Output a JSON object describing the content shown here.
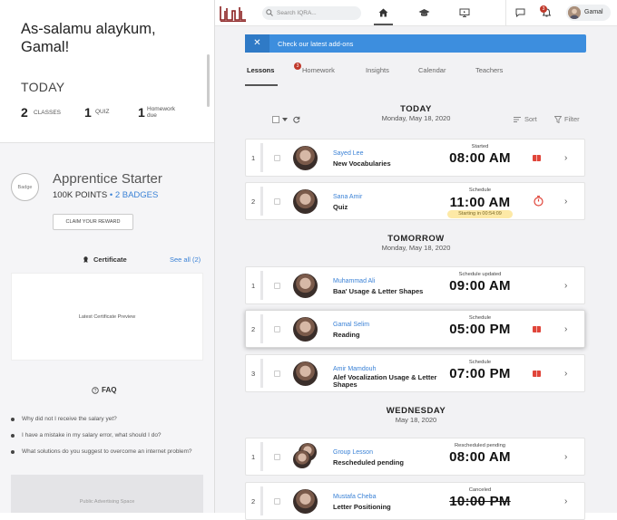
{
  "sidebar": {
    "greeting": "As-salamu alaykum, Gamal!",
    "today_label": "TODAY",
    "stats": [
      {
        "count": "2",
        "label": "CLASSES"
      },
      {
        "count": "1",
        "label": "QUIZ"
      },
      {
        "count": "1",
        "label": "Homework due"
      }
    ],
    "badge_placeholder": "Badge",
    "level_name": "Apprentice Starter",
    "points": "100K POINTS",
    "separator": "•",
    "badges": "2 BADGES",
    "claim_label": "CLAIM YOUR REWARD",
    "certificate_title": "Certificate",
    "see_all": "See all (2)",
    "certificate_preview": "Latest Certificate Preview",
    "faq_title": "FAQ",
    "faq_items": [
      "Why did not I receive the salary yet?",
      "I have a mistake in my salary error, what should I do?",
      "What solutions do you suggest to overcome an internet problem?"
    ],
    "ad_label": "Public Advertising Space"
  },
  "topbar": {
    "logo_text": "IQRA",
    "search_placeholder": "Search IQRA...",
    "notifications_count": "3",
    "user_name": "Gamal"
  },
  "banner": {
    "text": "Check our latest add-ons",
    "close": "✕"
  },
  "tabs": [
    {
      "label": "Lessons"
    },
    {
      "label": "Homework",
      "badge": "3"
    },
    {
      "label": "Insights"
    },
    {
      "label": "Calendar"
    },
    {
      "label": "Teachers"
    }
  ],
  "toolbar": {
    "sort_label": "Sort",
    "filter_label": "Filter"
  },
  "days": [
    {
      "title": "TODAY",
      "date": "Monday, May 18, 2020",
      "lessons": [
        {
          "num": "1",
          "teacher": "Sayed Lee",
          "lesson": "New Vocabularies",
          "status": "Started",
          "time": "08:00 AM",
          "action": "book"
        },
        {
          "num": "2",
          "teacher": "Sana Amir",
          "lesson": "Quiz",
          "status": "Schedule",
          "time": "11:00 AM",
          "note": "Starting in 00:54:09",
          "action": "timer"
        }
      ]
    },
    {
      "title": "TOMORROW",
      "date": "Monday, May 18, 2020",
      "lessons": [
        {
          "num": "1",
          "teacher": "Muhammad Ali",
          "lesson": "Baa' Usage & Letter Shapes",
          "status": "Schedule updated",
          "time": "09:00 AM",
          "action": "none"
        },
        {
          "num": "2",
          "teacher": "Gamal Selim",
          "lesson": "Reading",
          "status": "Schedule",
          "time": "05:00 PM",
          "action": "book"
        },
        {
          "num": "3",
          "teacher": "Amir Mamdouh",
          "lesson": "Alef Vocalization Usage & Letter Shapes",
          "status": "Schedule",
          "time": "07:00 PM",
          "action": "book"
        }
      ]
    },
    {
      "title": "WEDNESDAY",
      "date": "May 18, 2020",
      "lessons": [
        {
          "num": "1",
          "teacher": "Group Lesson",
          "lesson": "Rescheduled pending",
          "status": "Rescheduled pending",
          "time": "08:00 AM",
          "action": "none"
        },
        {
          "num": "2",
          "teacher": "Mustafa Cheba",
          "lesson": "Letter Positioning",
          "status": "Canceled",
          "time": "10:00 PM",
          "action": "none"
        }
      ]
    }
  ],
  "colors": {
    "accent": "#3d8ede",
    "danger": "#c0392b",
    "link": "#3b82d6"
  }
}
